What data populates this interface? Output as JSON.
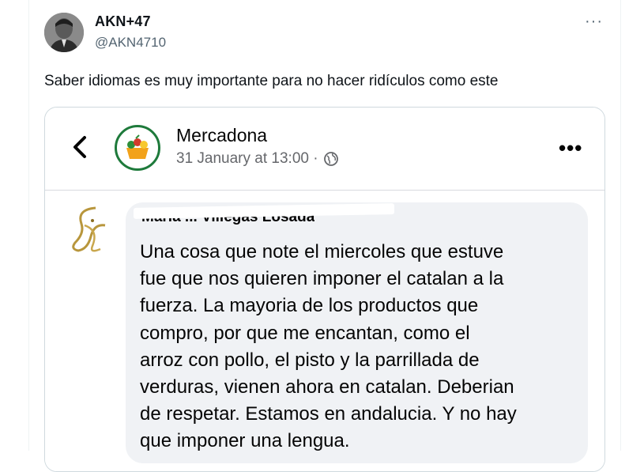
{
  "tweet": {
    "author_name": "AKN+47",
    "author_handle": "@AKN4710",
    "more_label": "···",
    "text": "Saber idiomas es muy importante para no hacer ridículos como este"
  },
  "embedded_post": {
    "page_name": "Mercadona",
    "timestamp": "31 January at 13:00 ·",
    "more_label": "•••",
    "commenter_name": "Maria ... Villegas Losada",
    "comment_text": "Una cosa que note el miercoles que estuve\nfue que nos quieren imponer el catalan a la\nfuerza. La mayoria de los productos que\ncompro, por que me encantan, como el\narroz con pollo, el pisto y la parrillada de\nverduras, vienen ahora en catalan. Deberian\nde respetar. Estamos en andalucia. Y no hay\nque imponer una lengua."
  },
  "colors": {
    "text_primary": "#0f1419",
    "text_secondary": "#536471",
    "fb_meta": "#65676b",
    "bubble": "#f0f2f5",
    "mercadona_green": "#1e7a3b"
  },
  "icons": [
    "back-chevron-icon",
    "globe-icon",
    "more-icon",
    "mercadona-logo-icon"
  ]
}
